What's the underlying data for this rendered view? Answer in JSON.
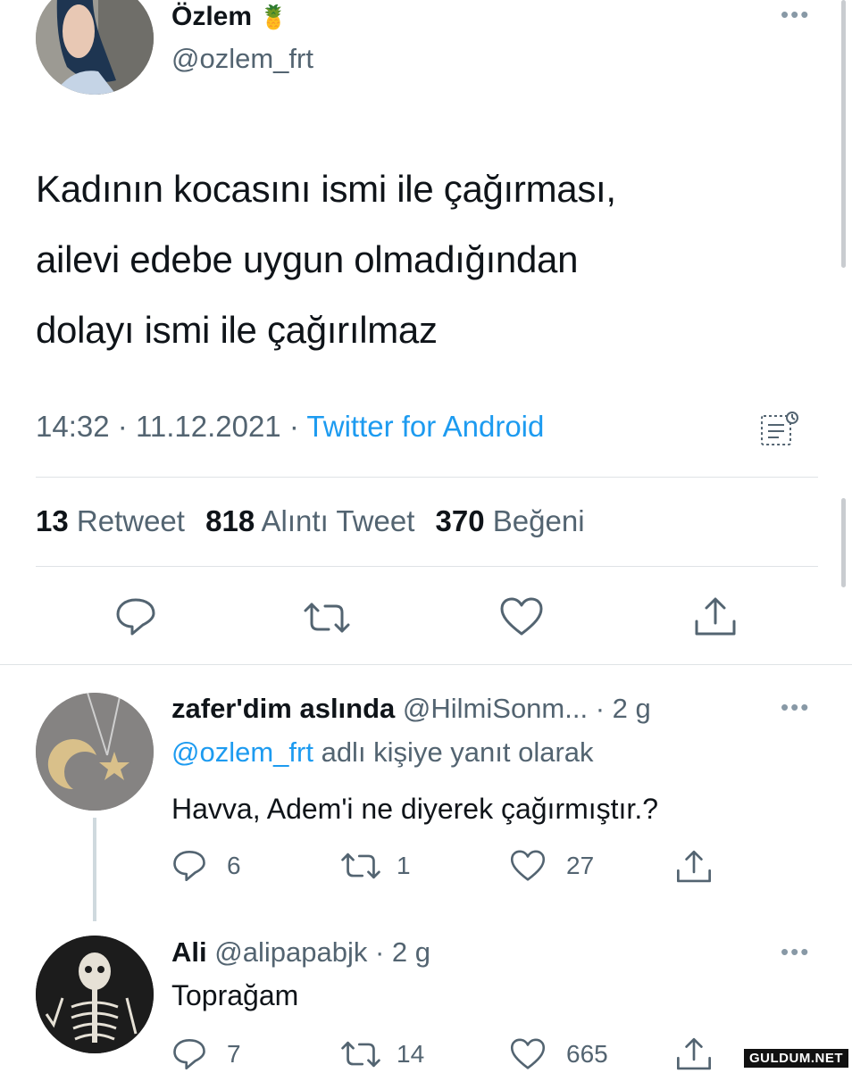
{
  "main_tweet": {
    "author_name": "Özlem",
    "name_emoji": "🍍",
    "handle": "@ozlem_frt",
    "text_lines": [
      "Kadının kocasını ismi ile çağırması,",
      "ailevi edebe uygun olmadığından",
      "dolayı ismi ile çağırılmaz"
    ],
    "time": "14:32",
    "sep": "·",
    "date": "11.12.2021",
    "source": "Twitter for Android",
    "stats": {
      "retweets_count": "13",
      "retweets_label": "Retweet",
      "quotes_count": "818",
      "quotes_label": "Alıntı Tweet",
      "likes_count": "370",
      "likes_label": "Beğeni"
    }
  },
  "reply1": {
    "author_name": "zafer'dim aslında",
    "handle": "@HilmiSonm...",
    "age": "· 2 g",
    "replying_to_handle": "@ozlem_frt",
    "replying_to_text": "adlı kişiye yanıt olarak",
    "text": "Havva, Adem'i ne diyerek çağırmıştır.?",
    "replies": "6",
    "retweets": "1",
    "likes": "27"
  },
  "reply2": {
    "author_name": "Ali",
    "handle": "@alipapabjk",
    "age": "· 2 g",
    "text": "Toprağam",
    "replies": "7",
    "retweets": "14",
    "likes": "665"
  },
  "watermark": "GULDUM.NET",
  "colors": {
    "accent": "#1d9bf0",
    "muted": "#536471",
    "divider": "#dfe3e6"
  }
}
